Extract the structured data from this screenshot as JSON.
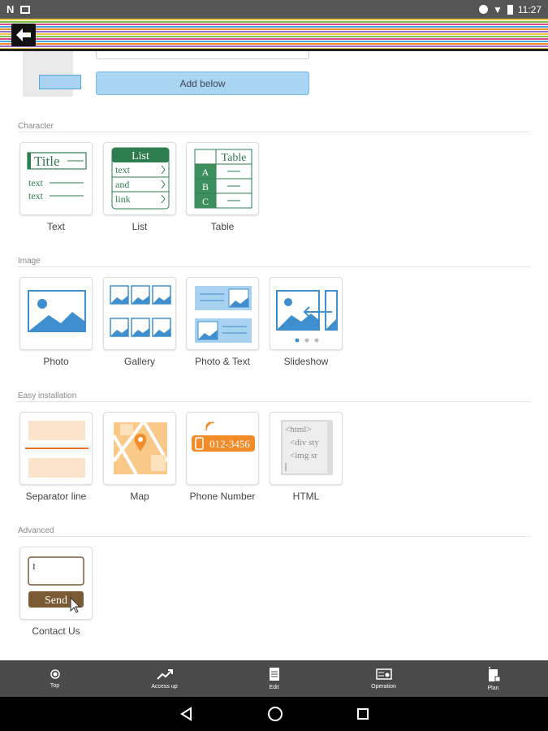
{
  "status": {
    "time": "11:27",
    "left_icons": [
      "n-icon",
      "image-icon"
    ],
    "right_icons": [
      "dnd-icon",
      "wifi-icon",
      "battery-icon"
    ]
  },
  "header": {
    "back_icon": "arrow-left-icon"
  },
  "top": {
    "add_below_label": "Add below"
  },
  "sections": {
    "character": {
      "title": "Character",
      "items": [
        "Text",
        "List",
        "Table"
      ]
    },
    "image": {
      "title": "Image",
      "items": [
        "Photo",
        "Gallery",
        "Photo & Text",
        "Slideshow"
      ]
    },
    "easy": {
      "title": "Easy installation",
      "items": [
        "Separator line",
        "Map",
        "Phone Number",
        "HTML"
      ]
    },
    "advanced": {
      "title": "Advanced",
      "items": [
        "Contact Us"
      ]
    }
  },
  "thumbs": {
    "text": {
      "title": "Title",
      "line1": "text",
      "line2": "text"
    },
    "list": {
      "header": "List",
      "rows": [
        "text",
        "and",
        "link"
      ]
    },
    "table": {
      "header": "Table",
      "rows": [
        "A",
        "B",
        "C"
      ]
    },
    "phone": {
      "number": "012-3456"
    },
    "html": {
      "lines": [
        "<html>",
        "<div sty",
        "<img sr"
      ]
    },
    "contact": {
      "send": "Send",
      "cursor": "I"
    }
  },
  "bottom_nav": [
    {
      "label": "Top",
      "icon": "dot-icon"
    },
    {
      "label": "Access up",
      "icon": "trend-up-icon"
    },
    {
      "label": "Edit",
      "icon": "document-icon"
    },
    {
      "label": "Operation",
      "icon": "settings-card-icon"
    },
    {
      "label": "Plan",
      "icon": "plan-icon"
    }
  ],
  "colors": {
    "green": "#2e7d4f",
    "blue": "#3f8fcf",
    "orange": "#f28c28",
    "brown": "#7a5a32"
  }
}
